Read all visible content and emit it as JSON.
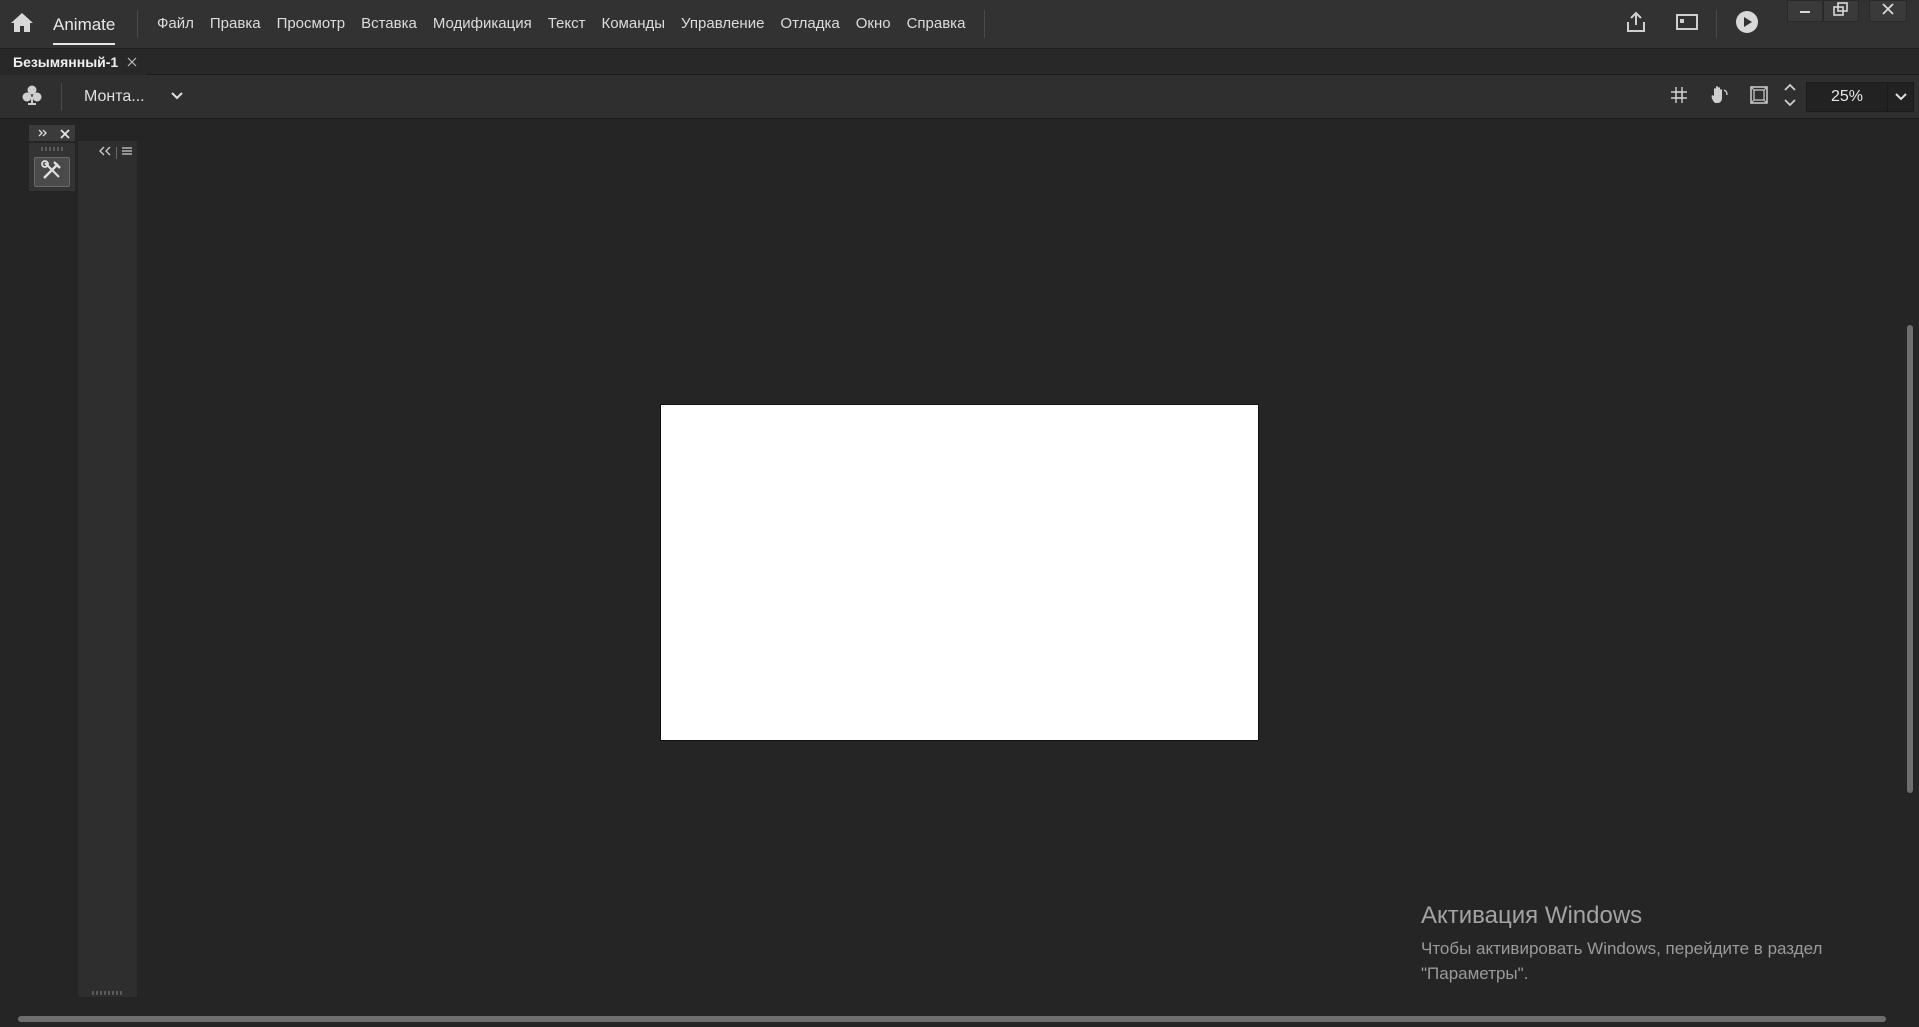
{
  "app": {
    "name": "Animate",
    "menu": [
      "Файл",
      "Правка",
      "Просмотр",
      "Вставка",
      "Модификация",
      "Текст",
      "Команды",
      "Управление",
      "Отладка",
      "Окно",
      "Справка"
    ],
    "top_icons": [
      "share-icon",
      "workspace-layout-icon",
      "play-icon"
    ],
    "window_controls": [
      "minimize-icon",
      "restore-icon",
      "close-icon"
    ]
  },
  "document": {
    "tab_label": "Безымянный-1"
  },
  "editbar": {
    "scene_icon": "symbol-icon",
    "scene_label": "Монта...",
    "tools": [
      "snap-icon",
      "hand-pan-icon",
      "clip-content-icon",
      "stage-step-icon"
    ],
    "zoom": "25%"
  },
  "panels": {
    "tool_icon": "tools-icon"
  },
  "stage": {
    "color": "#ffffff"
  },
  "watermark": {
    "title": "Активация Windows",
    "text_line1": "Чтобы активировать Windows, перейдите в раздел",
    "text_line2": "\"Параметры\"."
  },
  "colors": {
    "background": "#252525",
    "bar": "#323232"
  }
}
